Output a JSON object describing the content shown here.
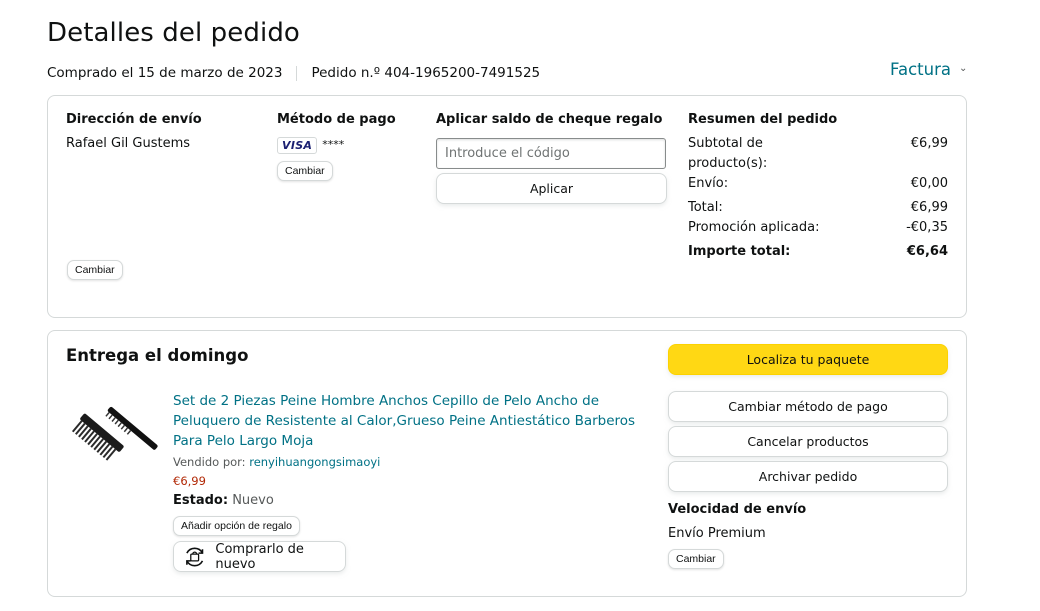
{
  "header": {
    "title": "Detalles del pedido",
    "purchased": "Comprado el 15 de marzo de 2023",
    "order_number": "Pedido n.º 404-1965200-7491525",
    "invoice_label": "Factura"
  },
  "shipping": {
    "heading": "Dirección de envío",
    "name": "Rafael Gil Gustems",
    "change_label": "Cambiar"
  },
  "payment": {
    "heading": "Método de pago",
    "card_brand": "VISA",
    "card_mask": "****",
    "change_label": "Cambiar"
  },
  "gift_card": {
    "heading": "Aplicar saldo de cheque regalo",
    "placeholder": "Introduce el código",
    "apply_label": "Aplicar"
  },
  "summary": {
    "heading": "Resumen del pedido",
    "rows": [
      {
        "label": "Subtotal de producto(s):",
        "value": "€6,99"
      },
      {
        "label": "Envío:",
        "value": "€0,00"
      },
      {
        "label": "Total:",
        "value": "€6,99"
      },
      {
        "label": "Promoción aplicada:",
        "value": "-€0,35"
      },
      {
        "label": "Importe total:",
        "value": "€6,64"
      }
    ]
  },
  "delivery": {
    "title": "Entrega el domingo",
    "product": {
      "name": "Set de 2 Piezas Peine Hombre Anchos Cepillo de Pelo Ancho de Peluquero de Resistente al Calor,Grueso Peine Antiestático Barberos Para Pelo Largo Moja",
      "sold_by_label": "Vendido por:",
      "seller": "renyihuangongsimaoyi",
      "price": "€6,99",
      "status_label": "Estado:",
      "status_value": "Nuevo",
      "gift_option_label": "Añadir opción de regalo",
      "buy_again_label": "Comprarlo de nuevo"
    },
    "actions": {
      "track": "Localiza tu paquete",
      "change_payment": "Cambiar método de pago",
      "cancel": "Cancelar productos",
      "archive": "Archivar pedido"
    },
    "shipping_speed": {
      "heading": "Velocidad de envío",
      "value": "Envío Premium",
      "change_label": "Cambiar"
    }
  },
  "colors": {
    "link": "#007185",
    "price": "#b12704",
    "primary_button": "#ffd814",
    "border": "#d5d9d9"
  }
}
